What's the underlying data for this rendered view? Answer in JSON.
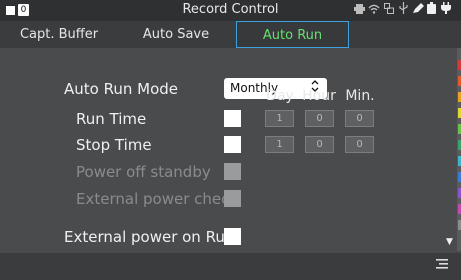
{
  "window": {
    "title": "Record Control",
    "badge": "0"
  },
  "status_icons": {
    "printer": "⎙",
    "wifi": "wifi-icon",
    "usb": "⎌",
    "usb2": "⇣",
    "pen": "✎",
    "battery": "▮",
    "plug": "⏚"
  },
  "tabs": [
    {
      "label": "Capt. Buffer"
    },
    {
      "label": "Auto Save"
    },
    {
      "label": "Auto Run",
      "selected": true
    }
  ],
  "mode": {
    "label": "Auto Run Mode",
    "value": "Monthly",
    "arrow": "⌃⌄"
  },
  "columns": {
    "day": "Day",
    "hour": "Hour",
    "min": "Min."
  },
  "run_time": {
    "label": "Run Time",
    "day": "1",
    "hour": "0",
    "min": "0"
  },
  "stop_time": {
    "label": "Stop Time",
    "day": "1",
    "hour": "0",
    "min": "0"
  },
  "power_off_standby": {
    "label": "Power off standby"
  },
  "external_power_check": {
    "label": "External power check"
  },
  "external_power_on_run": {
    "label": "External power on Run"
  },
  "colors": {
    "accent_tab_border": "#3fa0e0",
    "selected_tab_text": "#67e071"
  },
  "side_strips": [
    "#d33b3b",
    "#e05a2a",
    "#e8a321",
    "#e0d634",
    "#6cc04a",
    "#3aa36b",
    "#3fb6c8",
    "#3d7ad6",
    "#8a55c9",
    "#c24aa8",
    "#8c8c8c"
  ]
}
